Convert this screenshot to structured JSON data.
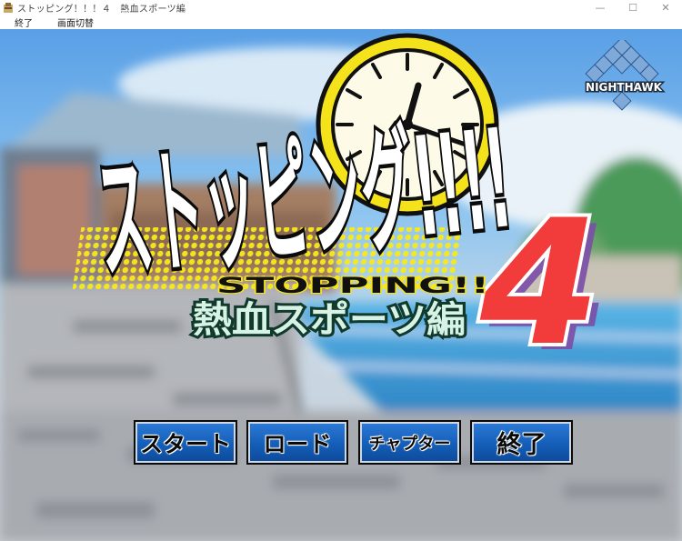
{
  "window": {
    "title": "ストッピング！！！４　熱血スポーツ編",
    "controls": {
      "minimize": "—",
      "maximize": "☐",
      "close": "✕"
    }
  },
  "menubar": {
    "items": [
      "終了",
      "画面切替"
    ]
  },
  "game": {
    "logo_main": "ストッピング!!!!",
    "logo_sub": "STOPPING!!",
    "logo_edition": "熱血スポーツ編",
    "logo_number": "4",
    "brand": "NIGHTHAWK",
    "colors": {
      "button_blue": "#1a66c4",
      "clock_yellow": "#f4e21a",
      "number_red": "#f23c3c",
      "edition_green": "#cfeede"
    }
  },
  "title_menu": {
    "buttons": [
      "スタート",
      "ロード",
      "チャプター",
      "終了"
    ]
  }
}
